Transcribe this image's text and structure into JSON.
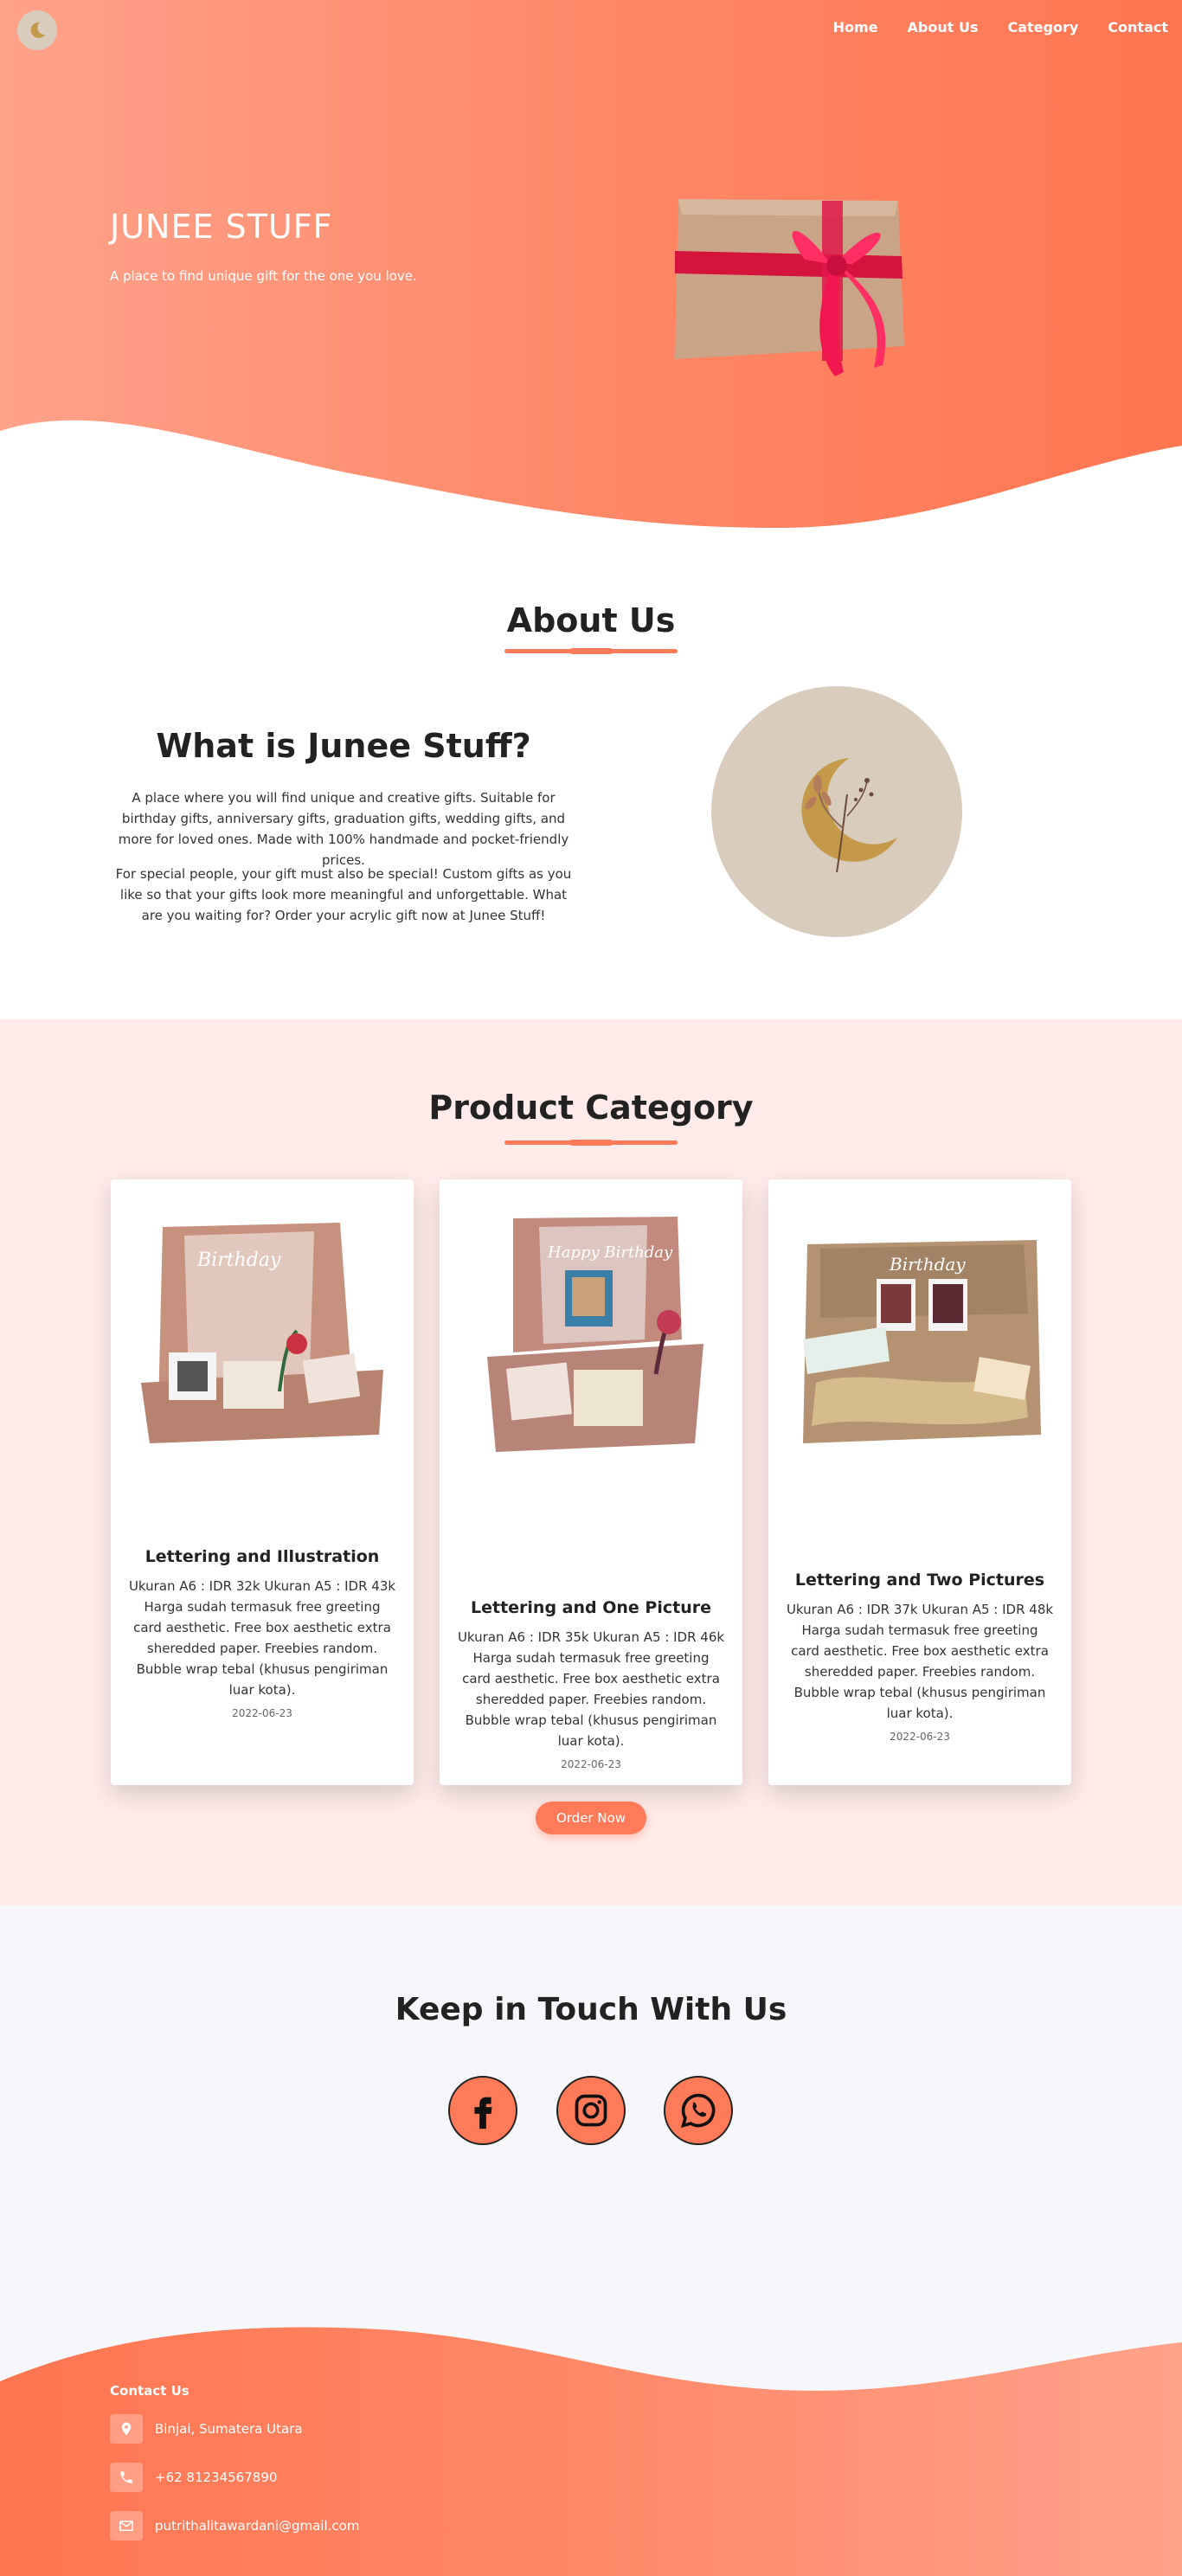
{
  "nav": {
    "items": [
      "Home",
      "About Us",
      "Category",
      "Contact"
    ]
  },
  "hero": {
    "title": "JUNEE STUFF",
    "subtitle": "A place to find unique gift for the one you love."
  },
  "about": {
    "section_title": "About Us",
    "heading": "What is Junee Stuff?",
    "paragraph1": "A place where you will find unique and creative gifts. Suitable for birthday gifts, anniversary gifts, graduation gifts, wedding gifts, and more for loved ones. Made with 100% handmade and pocket-friendly prices.",
    "paragraph2": "For special people, your gift must also be special! Custom gifts as you like so that your gifts look more meaningful and unforgettable. What are you waiting for? Order your acrylic gift now at Junee Stuff!"
  },
  "product": {
    "section_title": "Product Category",
    "cards": [
      {
        "title": "Lettering and Illustration",
        "description": "Ukuran A6 : IDR 32k Ukuran A5 : IDR 43k Harga sudah termasuk free greeting card aesthetic. Free box aesthetic extra sheredded paper. Freebies random. Bubble wrap tebal (khusus pengiriman luar kota).",
        "date": "2022-06-23",
        "image_text": "Birthday"
      },
      {
        "title": "Lettering and One Picture",
        "description": "Ukuran A6 : IDR 35k Ukuran A5 : IDR 46k Harga sudah termasuk free greeting card aesthetic. Free box aesthetic extra sheredded paper. Freebies random. Bubble wrap tebal (khusus pengiriman luar kota).",
        "date": "2022-06-23",
        "image_text": "Happy Birthday"
      },
      {
        "title": "Lettering and Two Pictures",
        "description": "Ukuran A6 : IDR 37k Ukuran A5 : IDR 48k Harga sudah termasuk free greeting card aesthetic. Free box aesthetic extra sheredded paper. Freebies random. Bubble wrap tebal (khusus pengiriman luar kota).",
        "date": "2022-06-23",
        "image_text": "Birthday"
      }
    ],
    "order_button": "Order Now"
  },
  "touch": {
    "title": "Keep in Touch With Us",
    "socials": [
      "facebook-icon",
      "instagram-icon",
      "whatsapp-icon"
    ]
  },
  "footer": {
    "heading": "Contact Us",
    "location": "Binjai, Sumatera Utara",
    "phone": "+62 81234567890",
    "email": "putrithalitawardani@gmail.com"
  },
  "colors": {
    "accent": "#ff7a59",
    "section_pink": "#ffecea",
    "logo_bg": "#d9ccbd",
    "moon_gold": "#c49a4a"
  }
}
